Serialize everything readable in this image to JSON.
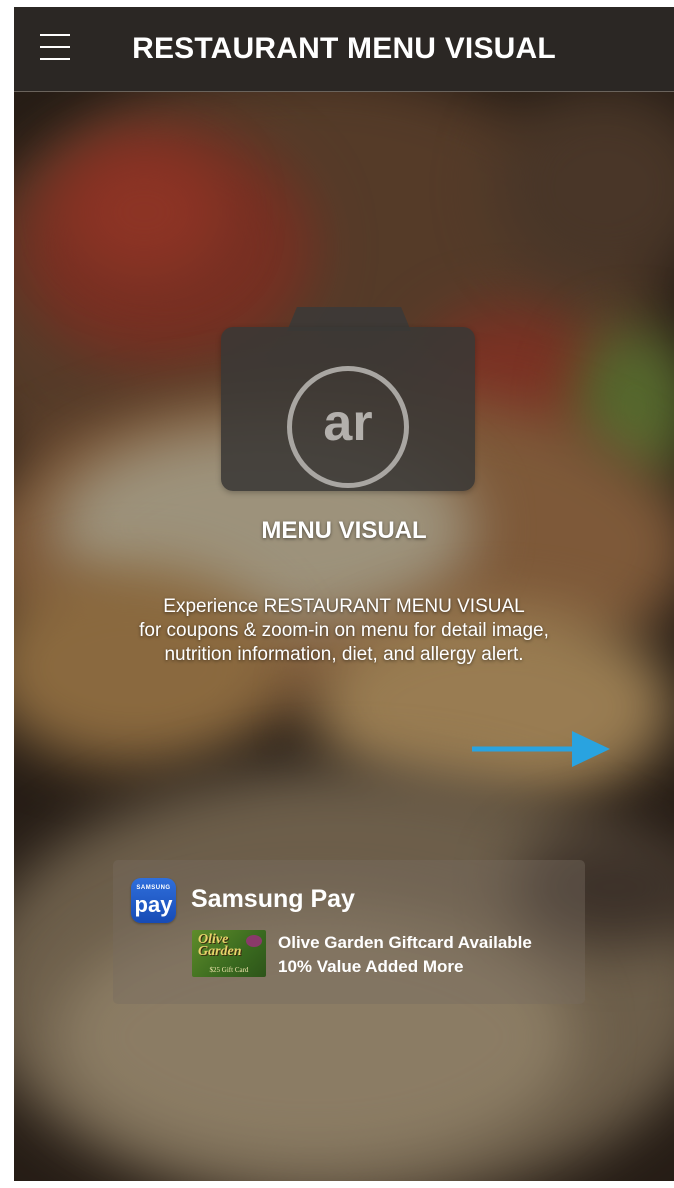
{
  "header": {
    "title": "RESTAURANT MENU VISUAL",
    "menu_icon": "hamburger-menu-icon"
  },
  "camera": {
    "icon": "ar-camera-icon",
    "lens_text": "ar"
  },
  "main": {
    "heading": "MENU VISUAL",
    "description_lines": [
      "Experience RESTAURANT MENU VISUAL",
      "for coupons & zoom-in on menu for detail image,",
      "nutrition information, diet, and allergy alert."
    ]
  },
  "next_arrow": {
    "icon": "arrow-right-icon",
    "color": "#29a3e0"
  },
  "payment": {
    "logo_small_text": "SAMSUNG",
    "logo_text": "pay",
    "title": "Samsung Pay",
    "giftcard_brand_line1": "Olive",
    "giftcard_brand_line2": "Garden",
    "giftcard_value": "$25 Gift Card",
    "offer_line1": "Olive Garden Giftcard Available",
    "offer_line2": "10% Value Added More",
    "logo_color": "#2a63d0"
  }
}
